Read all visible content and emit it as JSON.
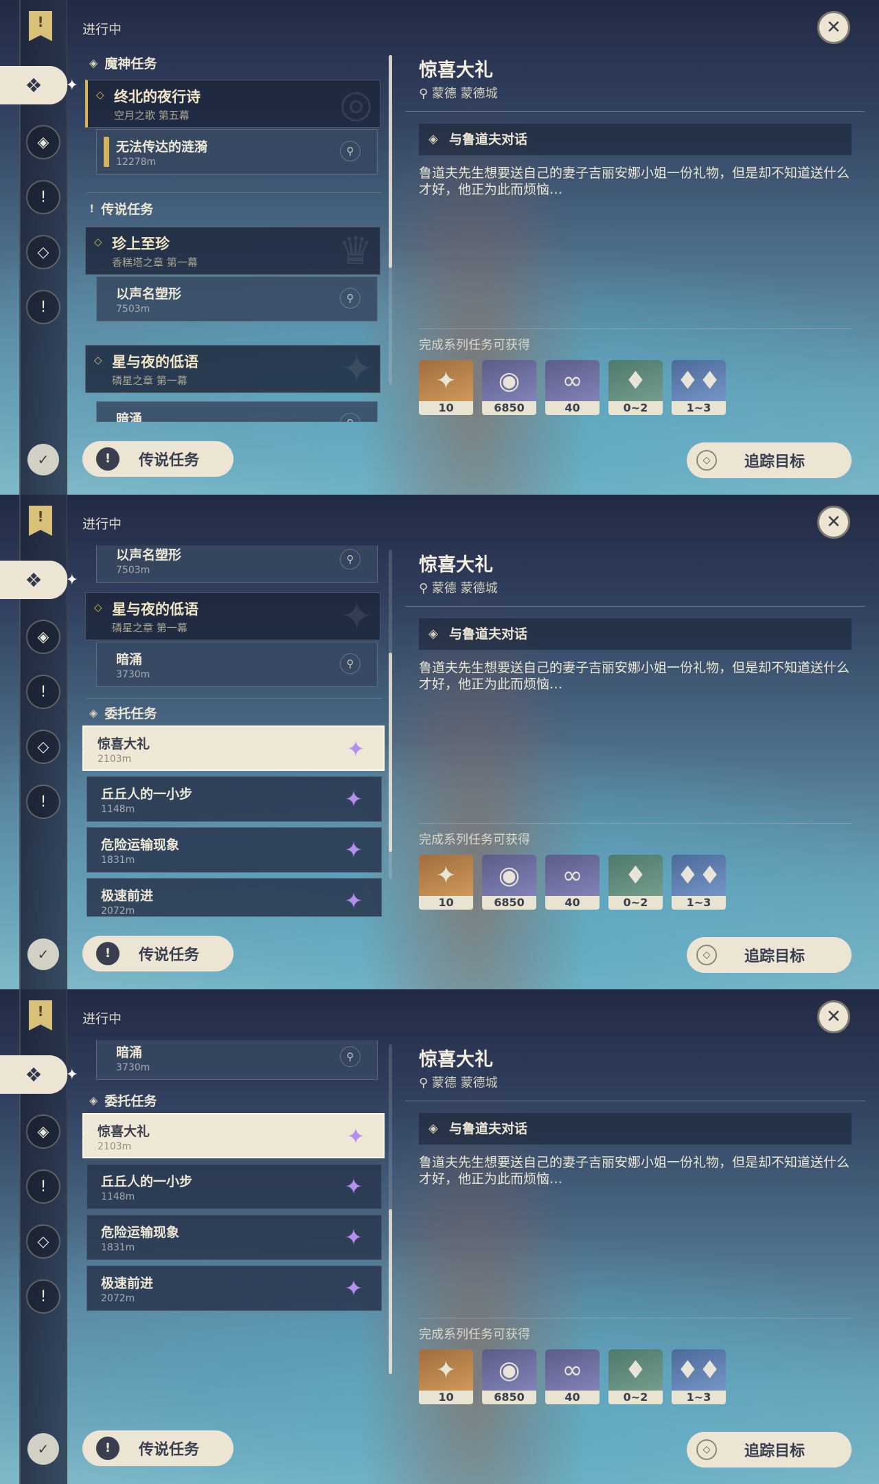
{
  "header": {
    "in_progress": "进行中"
  },
  "categories": {
    "archon": "魔神任务",
    "story": "传说任务",
    "commission": "委托任务"
  },
  "chapters": {
    "c1": {
      "title": "终北的夜行诗",
      "subtitle": "空月之歌 第五幕"
    },
    "c2": {
      "title": "珍上至珍",
      "subtitle": "香糕塔之章 第一幕"
    },
    "c3": {
      "title": "星与夜的低语",
      "subtitle": "磷星之章 第一幕"
    }
  },
  "subquests": {
    "s1": {
      "title": "无法传达的涟漪",
      "distance": "12278m"
    },
    "s2": {
      "title": "以声名塑形",
      "distance": "7503m"
    },
    "s3": {
      "title": "暗涌",
      "distance": "3730m"
    }
  },
  "commissions": [
    {
      "title": "惊喜大礼",
      "distance": "2103m"
    },
    {
      "title": "丘丘人的一小步",
      "distance": "1148m"
    },
    {
      "title": "危险运输现象",
      "distance": "1831m"
    },
    {
      "title": "极速前进",
      "distance": "2072m"
    }
  ],
  "detail": {
    "title": "惊喜大礼",
    "location": "蒙德 蒙德城",
    "step": "与鲁道夫对话",
    "description": "鲁道夫先生想要送自己的妻子吉丽安娜小姐一份礼物，但是却不知道送什么才好，他正为此而烦恼…",
    "rewards_label": "完成系列任务可获得",
    "rewards": [
      {
        "icon": "primogem-icon",
        "count": "10"
      },
      {
        "icon": "mora-icon",
        "count": "6850"
      },
      {
        "icon": "fate-icon",
        "count": "40"
      },
      {
        "icon": "crystal-small-icon",
        "count": "0~2"
      },
      {
        "icon": "crystal-cluster-icon",
        "count": "1~3"
      }
    ]
  },
  "buttons": {
    "legend": "传说任务",
    "track": "追踪目标",
    "close": "✕"
  },
  "colors": {
    "accent_gold": "#d9b35a",
    "commission_purple": "#b58ef0",
    "button_bg": "#ece5d3"
  }
}
